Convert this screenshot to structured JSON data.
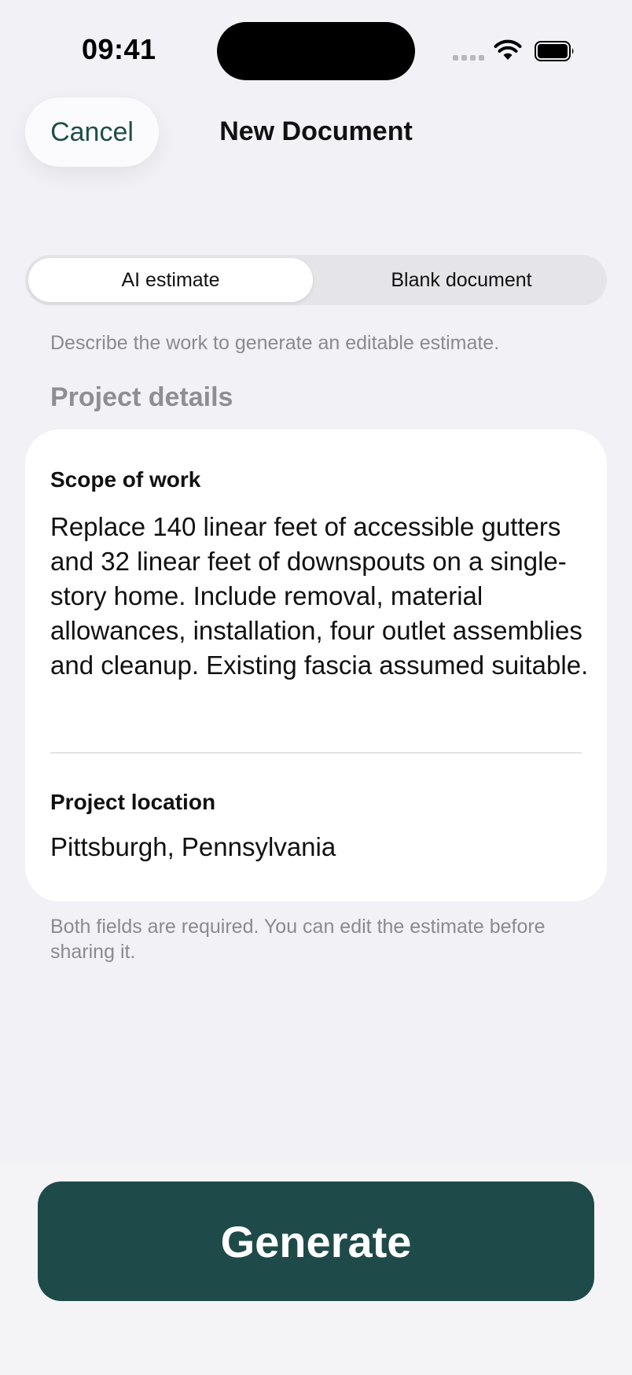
{
  "status_bar": {
    "time": "09:41"
  },
  "nav": {
    "cancel_label": "Cancel",
    "title": "New Document"
  },
  "mode_picker": {
    "options": [
      "AI estimate",
      "Blank document"
    ],
    "selected": "AI estimate"
  },
  "hint": "Describe the work to generate an editable estimate.",
  "section_header": "Project details",
  "form": {
    "scope_label": "Scope of work",
    "scope_value": "Replace 140 linear feet of accessible gutters and 32 linear feet of downspouts on a single-story home. Include removal, material allowances, installation, four outlet assemblies and cleanup. Existing fascia assumed suitable.",
    "location_label": "Project location",
    "location_value": "Pittsburgh, Pennsylvania"
  },
  "footnote": "Both fields are required. You can edit the estimate before sharing it.",
  "primary_action": {
    "label": "Generate"
  },
  "colors": {
    "accent": "#1f4a4a",
    "background": "#f1f1f6",
    "secondary_text": "#8a8a8f"
  },
  "icons": [
    "cellular-signal-icon",
    "wifi-icon",
    "battery-icon"
  ]
}
